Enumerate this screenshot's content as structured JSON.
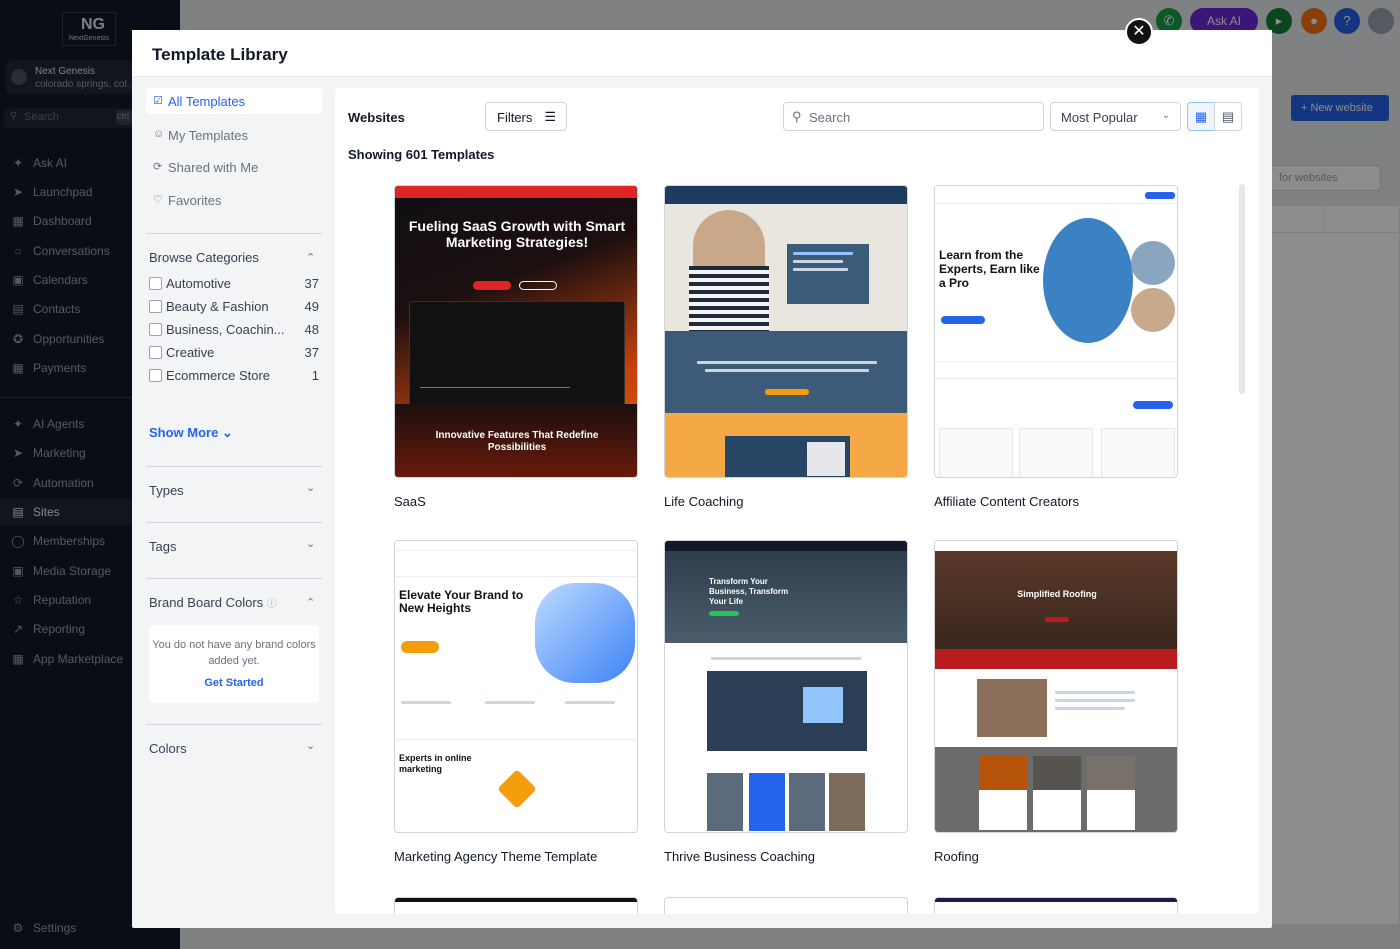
{
  "app": {
    "logo_text": "NextGenesis",
    "account_name": "Next Genesis",
    "account_location": "colorado springs, col...",
    "search_placeholder": "Search",
    "search_shortcut": "ctrl",
    "nav": [
      {
        "label": "Ask AI",
        "icon": "sparkle-icon"
      },
      {
        "label": "Launchpad",
        "icon": "rocket-icon"
      },
      {
        "label": "Dashboard",
        "icon": "grid-icon"
      },
      {
        "label": "Conversations",
        "icon": "chat-icon"
      },
      {
        "label": "Calendars",
        "icon": "calendar-icon"
      },
      {
        "label": "Contacts",
        "icon": "contacts-icon"
      },
      {
        "label": "Opportunities",
        "icon": "opportunities-icon"
      },
      {
        "label": "Payments",
        "icon": "payments-icon"
      },
      {
        "label": "AI Agents",
        "icon": "ai-agents-icon"
      },
      {
        "label": "Marketing",
        "icon": "send-icon"
      },
      {
        "label": "Automation",
        "icon": "automation-icon"
      },
      {
        "label": "Sites",
        "icon": "sites-icon",
        "active": true
      },
      {
        "label": "Memberships",
        "icon": "memberships-icon"
      },
      {
        "label": "Media Storage",
        "icon": "image-icon"
      },
      {
        "label": "Reputation",
        "icon": "star-icon"
      },
      {
        "label": "Reporting",
        "icon": "chart-line-icon"
      },
      {
        "label": "App Marketplace",
        "icon": "apps-icon"
      }
    ],
    "settings_label": "Settings",
    "topbar": {
      "ask_ai_label": "Ask AI"
    },
    "new_website_label": "New website",
    "bg_search_placeholder": "for websites"
  },
  "modal": {
    "title": "Template Library",
    "sidebar": {
      "nav": [
        {
          "label": "All Templates",
          "icon": "check-square-icon",
          "active": true
        },
        {
          "label": "My Templates",
          "icon": "user-icon"
        },
        {
          "label": "Shared with Me",
          "icon": "share-icon"
        },
        {
          "label": "Favorites",
          "icon": "heart-icon"
        }
      ],
      "browse_categories_title": "Browse Categories",
      "categories": [
        {
          "label": "Automotive",
          "count": "37"
        },
        {
          "label": "Beauty & Fashion",
          "count": "49"
        },
        {
          "label": "Business, Coachin...",
          "count": "48"
        },
        {
          "label": "Creative",
          "count": "37"
        },
        {
          "label": "Ecommerce Store",
          "count": "1"
        }
      ],
      "show_more_label": "Show More",
      "types_title": "Types",
      "tags_title": "Tags",
      "brand_colors_title": "Brand Board Colors",
      "brand_colors_empty": "You do not have any brand colors added yet.",
      "get_started_label": "Get Started",
      "colors_title": "Colors"
    },
    "content": {
      "title": "Websites",
      "filters_label": "Filters",
      "search_placeholder": "Search",
      "sort_value": "Most Popular",
      "count_text": "Showing 601 Templates",
      "templates": [
        {
          "name": "SaaS",
          "headline": "Fueling SaaS Growth with Smart Marketing Strategies!",
          "subheadline": "Innovative Features That Redefine Possibilities"
        },
        {
          "name": "Life Coaching"
        },
        {
          "name": "Affiliate Content Creators",
          "headline": "Learn from the Experts, Earn like a Pro"
        },
        {
          "name": "Marketing Agency Theme Template",
          "headline": "Elevate Your Brand to New Heights",
          "subheadline": "Experts in online marketing"
        },
        {
          "name": "Thrive Business Coaching",
          "headline": "Transform Your Business, Transform Your Life"
        },
        {
          "name": "Roofing",
          "headline": "Simplified Roofing"
        }
      ]
    }
  },
  "colors": {
    "accent": "#2563eb",
    "sidebar_bg": "#111827",
    "ask_ai": "#6d28d9"
  }
}
